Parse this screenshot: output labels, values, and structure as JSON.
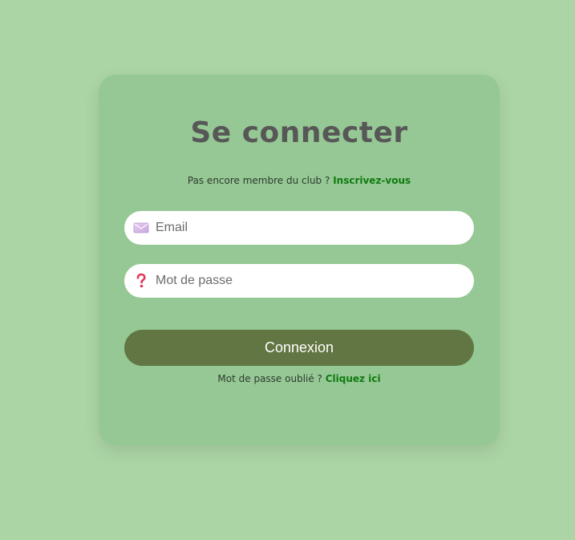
{
  "login": {
    "title": "Se connecter",
    "signup_prompt": "Pas encore membre du club ?",
    "signup_link": "Inscrivez-vous",
    "email_placeholder": "Email",
    "email_value": "",
    "password_placeholder": "Mot de passe",
    "password_value": "",
    "submit_label": "Connexion",
    "forgot_prompt": "Mot de passe oublié ?",
    "forgot_link": "Cliquez ici"
  },
  "icons": {
    "email": "envelope-icon",
    "password": "question-mark-icon"
  },
  "colors": {
    "page_background": "#acd5a6",
    "card_background": "#95c894",
    "title": "#575757",
    "link": "#107a10",
    "button": "#617642",
    "button_text": "#ffffff"
  }
}
